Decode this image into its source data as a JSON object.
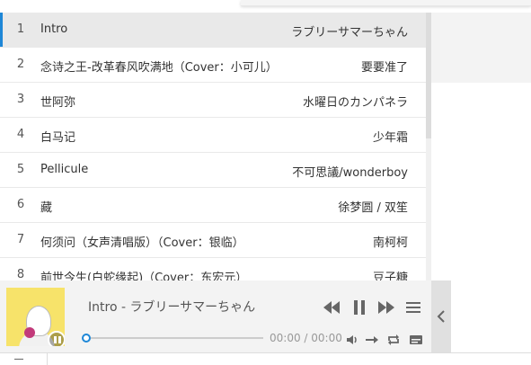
{
  "playlist": [
    {
      "index": "1",
      "title": "Intro",
      "artist": "ラブリーサマーちゃん",
      "active": true
    },
    {
      "index": "2",
      "title": "念诗之王-改革春风吹满地（Cover：小可儿）",
      "artist": "要要准了"
    },
    {
      "index": "3",
      "title": "世阿弥",
      "artist": "水曜日のカンパネラ"
    },
    {
      "index": "4",
      "title": "白马记",
      "artist": "少年霜"
    },
    {
      "index": "5",
      "title": "Pellicule",
      "artist": "不可思議/wonderboy"
    },
    {
      "index": "6",
      "title": "藏",
      "artist": "徐梦圆 / 双笙"
    },
    {
      "index": "7",
      "title": "何须问（女声清唱版）（Cover：银临）",
      "artist": "南柯柯"
    },
    {
      "index": "8",
      "title": "前世今生(白蛇缘起)（Cover：东宏元）",
      "artist": "豆子糖"
    }
  ],
  "player": {
    "now_playing": "Intro - ラブリーサマーちゃん",
    "time": "00:00 / 00:00",
    "progress": 0.0,
    "icons": {
      "prev": "rewind-icon",
      "pause": "pause-icon",
      "next": "fast-forward-icon",
      "menu": "playlist-menu-icon",
      "volume": "volume-icon",
      "order": "order-arrow-icon",
      "loop": "loop-icon",
      "lyrics": "lyrics-icon",
      "collapse": "chevron-left-icon"
    }
  },
  "colors": {
    "accent": "#1e87d7",
    "active_row_bg": "#e9e9e9",
    "player_bg": "#f3f3f3"
  }
}
